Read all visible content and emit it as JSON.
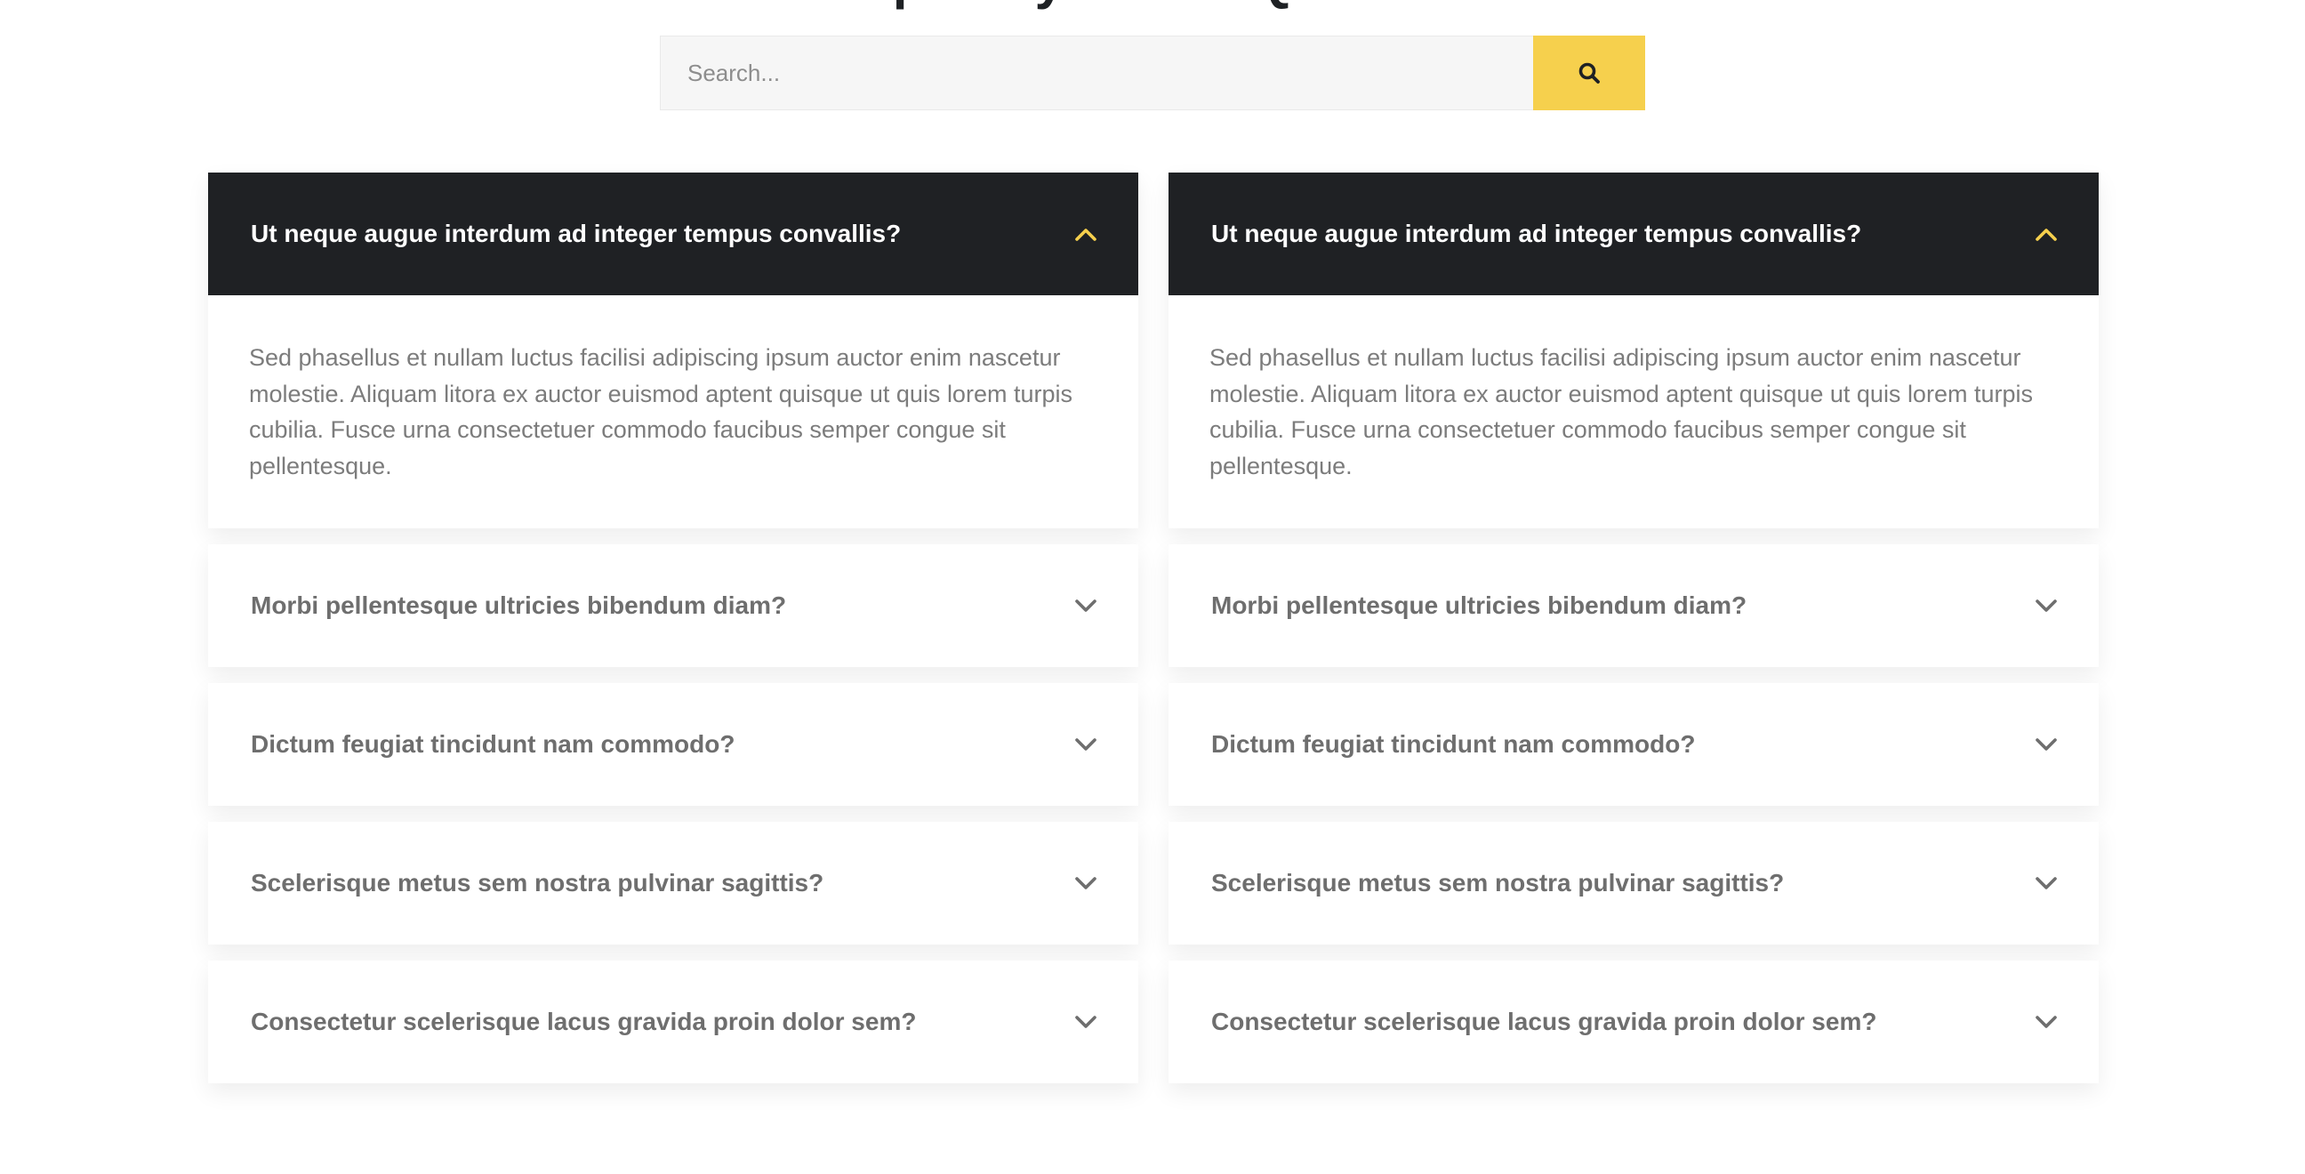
{
  "page": {
    "heading": "Frequently Asked Questions"
  },
  "search": {
    "placeholder": "Search...",
    "button_icon": "search-icon"
  },
  "colors": {
    "accent": "#f6d04d",
    "open_header_bg": "#1f2124",
    "question_text": "#6e6e6e",
    "answer_text": "#7c7c7c"
  },
  "columns": [
    {
      "items": [
        {
          "question": "Ut neque augue interdum ad integer tempus convallis?",
          "answer": "Sed phasellus et nullam luctus facilisi adipiscing ipsum auctor enim nascetur molestie. Aliquam litora ex auctor euismod aptent quisque ut quis lorem turpis cubilia. Fusce urna consectetuer commodo faucibus semper congue sit pellentesque.",
          "open": true
        },
        {
          "question": "Morbi pellentesque ultricies bibendum diam?",
          "open": false
        },
        {
          "question": "Dictum feugiat tincidunt nam commodo?",
          "open": false
        },
        {
          "question": "Scelerisque metus sem nostra pulvinar sagittis?",
          "open": false
        },
        {
          "question": "Consectetur scelerisque lacus gravida proin dolor sem?",
          "open": false
        }
      ]
    },
    {
      "items": [
        {
          "question": "Ut neque augue interdum ad integer tempus convallis?",
          "answer": "Sed phasellus et nullam luctus facilisi adipiscing ipsum auctor enim nascetur molestie. Aliquam litora ex auctor euismod aptent quisque ut quis lorem turpis cubilia. Fusce urna consectetuer commodo faucibus semper congue sit pellentesque.",
          "open": true
        },
        {
          "question": "Morbi pellentesque ultricies bibendum diam?",
          "open": false
        },
        {
          "question": "Dictum feugiat tincidunt nam commodo?",
          "open": false
        },
        {
          "question": "Scelerisque metus sem nostra pulvinar sagittis?",
          "open": false
        },
        {
          "question": "Consectetur scelerisque lacus gravida proin dolor sem?",
          "open": false
        }
      ]
    }
  ]
}
